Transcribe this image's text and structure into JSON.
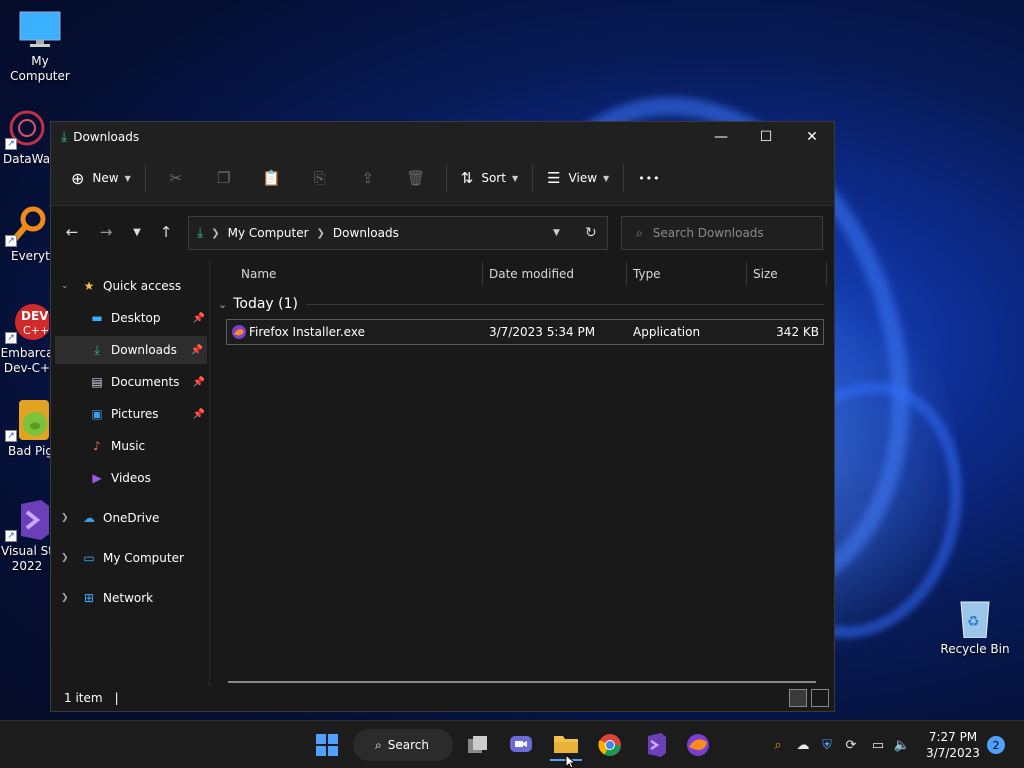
{
  "desktop": {
    "icons": [
      {
        "label": "My Computer"
      },
      {
        "label": "DataWag"
      },
      {
        "label": "Everyth"
      },
      {
        "label": "Embarca\nDev-C+"
      },
      {
        "label": "Bad Pig"
      },
      {
        "label": "Visual St\n2022"
      },
      {
        "label": "Recycle Bin"
      }
    ]
  },
  "window": {
    "title": "Downloads",
    "controls": {
      "minimize": "—",
      "maximize": "☐",
      "close": "✕"
    },
    "toolbar": {
      "new_label": "New",
      "sort_label": "Sort",
      "view_label": "View",
      "more_label": "•••"
    },
    "address": {
      "crumbs": [
        "My Computer",
        "Downloads"
      ]
    },
    "search": {
      "placeholder": "Search Downloads"
    },
    "nav": {
      "quick_access": "Quick access",
      "items": [
        {
          "label": "Desktop"
        },
        {
          "label": "Downloads"
        },
        {
          "label": "Documents"
        },
        {
          "label": "Pictures"
        },
        {
          "label": "Music"
        },
        {
          "label": "Videos"
        }
      ],
      "onedrive": "OneDrive",
      "my_computer": "My Computer",
      "network": "Network"
    },
    "columns": {
      "name": "Name",
      "date": "Date modified",
      "type": "Type",
      "size": "Size"
    },
    "group": {
      "label": "Today (1)"
    },
    "files": [
      {
        "name": "Firefox Installer.exe",
        "date": "3/7/2023 5:34 PM",
        "type": "Application",
        "size": "342 KB"
      }
    ],
    "status": {
      "count": "1 item",
      "cursor": "|"
    }
  },
  "taskbar": {
    "search_label": "Search",
    "clock_time": "7:27 PM",
    "clock_date": "3/7/2023",
    "notifications": "2"
  },
  "colors": {
    "accent": "#4ea1ff",
    "download_green": "#33c08a",
    "folder_yellow": "#f3c24a"
  }
}
